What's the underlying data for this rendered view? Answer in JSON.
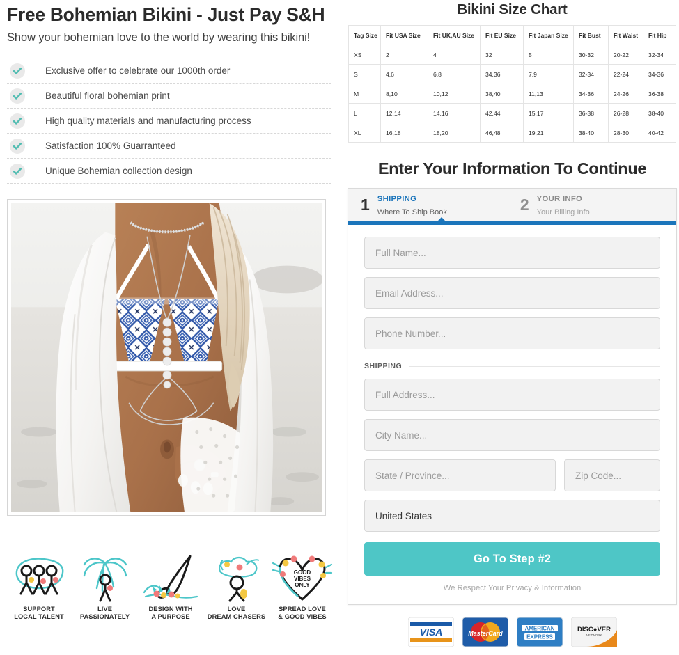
{
  "offer": {
    "headline": "Free Bohemian Bikini - Just Pay S&H",
    "subheadline": "Show your bohemian love to the world by wearing this bikini!",
    "benefits": [
      "Exclusive offer to celebrate our 1000th order",
      "Beautiful floral bohemian print",
      "High quality materials and manufacturing process",
      "Satisfaction 100% Guarranteed",
      "Unique Bohemian collection design"
    ]
  },
  "brand_values": [
    {
      "icon": "three-people-icon",
      "line1": "SUPPORT",
      "line2": "LOCAL TALENT"
    },
    {
      "icon": "palm-tree-person-icon",
      "line1": "LIVE",
      "line2": "PASSIONATELY"
    },
    {
      "icon": "paintbrush-flowers-icon",
      "line1": "DESIGN WITH",
      "line2": "A PURPOSE"
    },
    {
      "icon": "dreamer-person-icon",
      "line1": "LOVE",
      "line2": "DREAM CHASERS"
    },
    {
      "icon": "good-vibes-heart-icon",
      "line1": "SPREAD LOVE",
      "line2": "& GOOD VIBES"
    }
  ],
  "size_chart": {
    "title": "Bikini Size Chart",
    "headers": [
      "Tag Size",
      "Fit USA Size",
      "Fit UK,AU Size",
      "Fit EU Size",
      "Fit Japan Size",
      "Fit Bust",
      "Fit Waist",
      "Fit Hip"
    ],
    "rows": [
      [
        "XS",
        "2",
        "4",
        "32",
        "5",
        "30-32",
        "20-22",
        "32-34"
      ],
      [
        "S",
        "4,6",
        "6,8",
        "34,36",
        "7,9",
        "32-34",
        "22-24",
        "34-36"
      ],
      [
        "M",
        "8,10",
        "10,12",
        "38,40",
        "11,13",
        "34-36",
        "24-26",
        "36-38"
      ],
      [
        "L",
        "12,14",
        "14,16",
        "42,44",
        "15,17",
        "36-38",
        "26-28",
        "38-40"
      ],
      [
        "XL",
        "16,18",
        "18,20",
        "46,48",
        "19,21",
        "38-40",
        "28-30",
        "40-42"
      ]
    ]
  },
  "form": {
    "title": "Enter Your Information To Continue",
    "steps": [
      {
        "number": "1",
        "name": "SHIPPING",
        "description": "Where To Ship Book",
        "active": true
      },
      {
        "number": "2",
        "name": "YOUR INFO",
        "description": "Your Billing Info",
        "active": false
      }
    ],
    "fields": {
      "full_name_placeholder": "Full Name...",
      "email_placeholder": "Email Address...",
      "phone_placeholder": "Phone Number...",
      "address_placeholder": "Full Address...",
      "city_placeholder": "City Name...",
      "state_placeholder": "State / Province...",
      "zip_placeholder": "Zip Code...",
      "country_value": "United States"
    },
    "shipping_divider_label": "SHIPPING",
    "submit_label": "Go To Step #2",
    "privacy_note": "We Respect Your Privacy & Information"
  },
  "payment_cards": [
    {
      "name": "visa-card-icon",
      "label": "VISA"
    },
    {
      "name": "mastercard-card-icon",
      "label": "MasterCard"
    },
    {
      "name": "amex-card-icon",
      "label": "AMERICAN EXPRESS"
    },
    {
      "name": "discover-card-icon",
      "label": "DISCOVER NETWORK"
    }
  ],
  "colors": {
    "accent_teal": "#4ec6c6",
    "accent_blue": "#1b75bb",
    "text_dark": "#2b2b2b",
    "field_bg": "#f2f2f2"
  }
}
